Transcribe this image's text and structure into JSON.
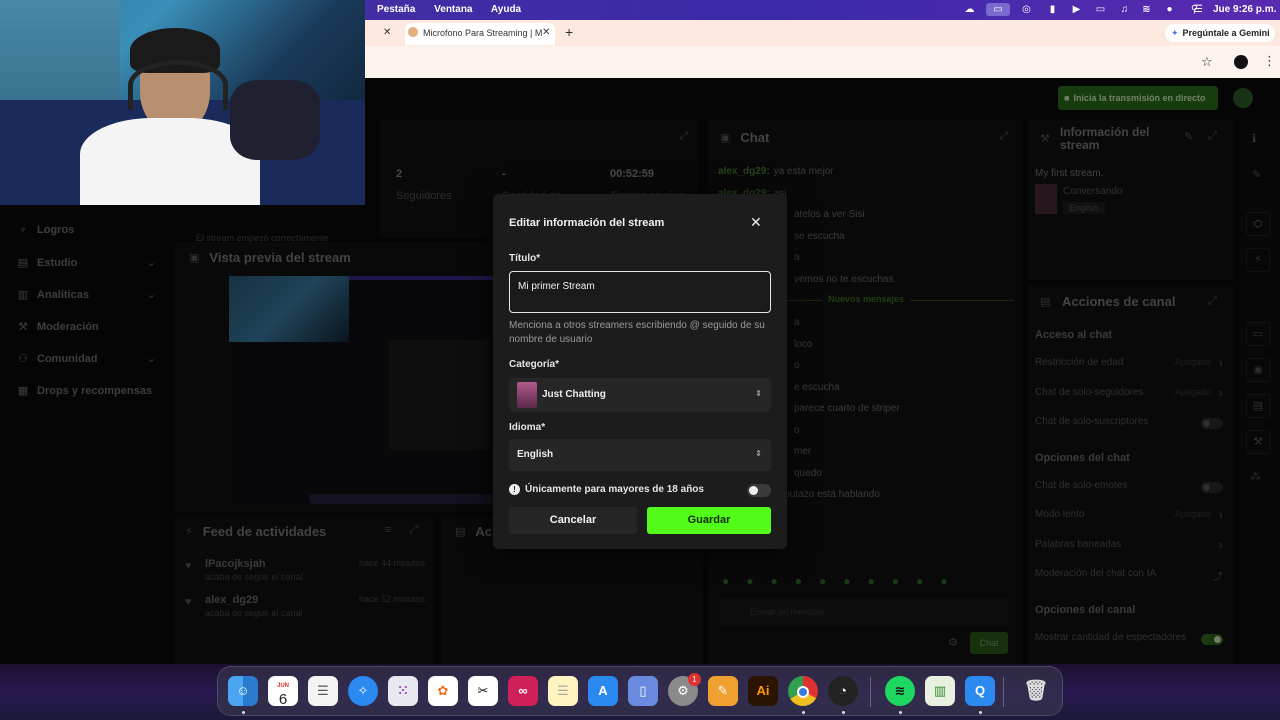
{
  "menubar": {
    "items": [
      "Pestaña",
      "Ventana",
      "Ayuda"
    ],
    "clock": "Jue 9:26 p.m."
  },
  "browser": {
    "tab_title": "Microfono Para Streaming | M",
    "gemini_label": "Pregúntale a Gemini"
  },
  "dashboard": {
    "go_live_label": "Inicia la transmisión en directo",
    "sidebar": [
      {
        "label": "Logros",
        "icon": "trophy-icon"
      },
      {
        "label": "Estudio",
        "icon": "studio-icon",
        "expandable": true
      },
      {
        "label": "Analíticas",
        "icon": "analytics-icon",
        "expandable": true
      },
      {
        "label": "Moderación",
        "icon": "wrench-icon"
      },
      {
        "label": "Comunidad",
        "icon": "community-icon",
        "expandable": true
      },
      {
        "label": "Drops y recompensas",
        "icon": "drops-icon"
      }
    ],
    "stats": {
      "followers_value": "2",
      "followers_label": "Seguidores",
      "viewers_value": "-",
      "viewers_label": "Cantidad de",
      "time_value": "00:52:59",
      "time_label": "Tiempo en vivo"
    },
    "status_text": "El stream empezó correctamente",
    "preview_title": "Vista previa del stream",
    "activity_feed": {
      "title": "Feed de actividades",
      "items": [
        {
          "user": "lPacojksjah",
          "action": "acaba de seguir el canal",
          "time": "hace 44 minutos"
        },
        {
          "user": "alex_dg29",
          "action": "acaba de seguir el canal",
          "time": "hace 52 minutos"
        }
      ]
    },
    "second_panel_title": "Ac",
    "chat": {
      "title": "Chat",
      "messages": [
        {
          "user": "alex_dg29:",
          "text": "ya esta mejor"
        },
        {
          "user": "alex_dg29:",
          "text": "asi"
        },
        {
          "user": "",
          "text": "atelos a ver Sisi"
        },
        {
          "user": "",
          "text": "se escucha"
        },
        {
          "user": "",
          "text": "a"
        },
        {
          "user": "",
          "text": "vemos no te escuchas"
        },
        {
          "user": "",
          "text": "a"
        },
        {
          "user": "",
          "text": "loco"
        },
        {
          "user": "",
          "text": "o"
        },
        {
          "user": "",
          "text": "e escucha"
        },
        {
          "user": "",
          "text": "parece cuarto de striper"
        },
        {
          "user": "",
          "text": "o"
        },
        {
          "user": "",
          "text": "mer"
        },
        {
          "user": "",
          "text": "quedo"
        },
        {
          "user": "alex_dg29:",
          "text": "el putazo está hablando"
        }
      ],
      "new_messages_label": "Nuevos mensajes",
      "input_placeholder": "Enviar un mensaje",
      "send_label": "Chat"
    },
    "stream_info": {
      "title": "Información del stream",
      "stream_title": "My first stream.",
      "category": "Conversando",
      "language": "English"
    },
    "channel_actions": {
      "title": "Acciones de canal",
      "chat_access_heading": "Acceso al chat",
      "chat_access_items": [
        {
          "label": "Restricción de edad",
          "value": "Apagado",
          "type": "arrow"
        },
        {
          "label": "Chat de solo-seguidores",
          "value": "Apagado",
          "type": "arrow"
        },
        {
          "label": "Chat de solo-suscriptores",
          "value": "",
          "type": "toggle-off"
        }
      ],
      "chat_options_heading": "Opciones del chat",
      "chat_options_items": [
        {
          "label": "Chat de solo-emotes",
          "value": "",
          "type": "toggle-off"
        },
        {
          "label": "Modo lento",
          "value": "Apagado",
          "type": "arrow"
        },
        {
          "label": "Palabras baneadas",
          "value": "",
          "type": "arrow"
        },
        {
          "label": "Moderación del chat con IA",
          "value": "",
          "type": "external"
        }
      ],
      "channel_options_heading": "Opciones del canal",
      "channel_options_items": [
        {
          "label": "Mostrar cantidad de espectadores",
          "value": "",
          "type": "toggle-on"
        }
      ]
    }
  },
  "modal": {
    "title": "Editar información del stream",
    "title_label": "Título*",
    "title_value": "Mi primer Stream",
    "title_hint": "Menciona a otros streamers escribiendo @ seguido de su nombre de usuario",
    "category_label": "Categoría*",
    "category_value": "Just Chatting",
    "language_label": "Idioma*",
    "language_value": "English",
    "adult_label": "Únicamente para mayores de 18 años",
    "cancel_label": "Cancelar",
    "save_label": "Guardar"
  },
  "dock": {
    "calendar_month": "JUN",
    "calendar_day": "6",
    "settings_badge": "1"
  },
  "colors": {
    "accent_green": "#53fc18",
    "menubar": "#3a2aa8"
  }
}
